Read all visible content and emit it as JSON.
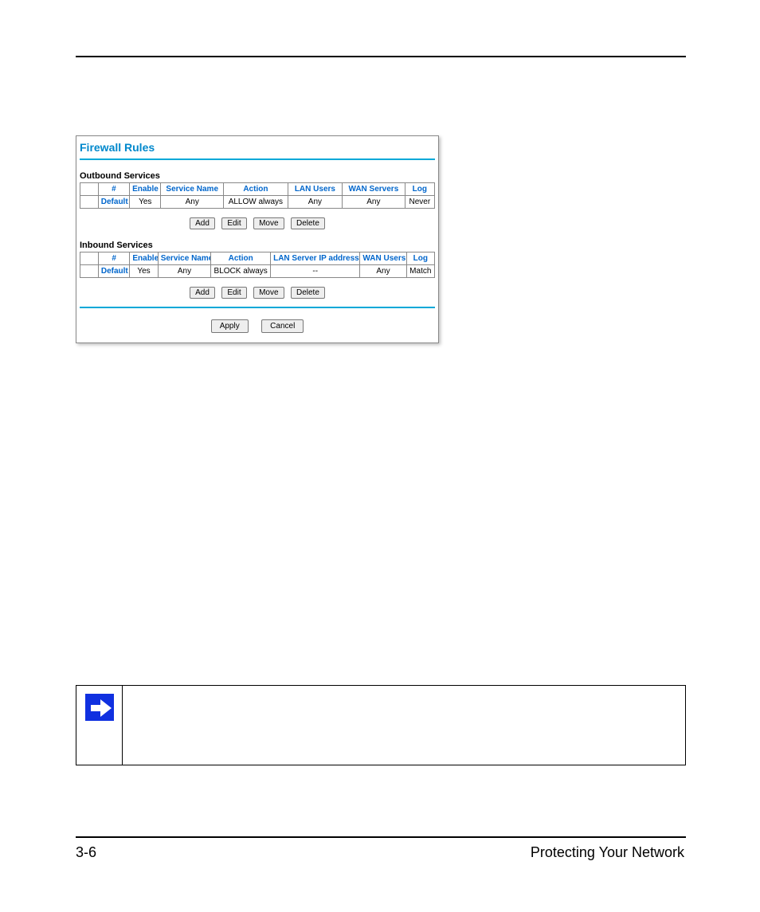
{
  "panel": {
    "title": "Firewall Rules",
    "outbound": {
      "label": "Outbound Services",
      "headers": [
        "",
        "#",
        "Enable",
        "Service Name",
        "Action",
        "LAN Users",
        "WAN Servers",
        "Log"
      ],
      "row": {
        "sel": "",
        "num": "Default",
        "enable": "Yes",
        "service": "Any",
        "action": "ALLOW always",
        "lan": "Any",
        "wan": "Any",
        "log": "Never"
      }
    },
    "inbound": {
      "label": "Inbound Services",
      "headers": [
        "",
        "#",
        "Enable",
        "Service Name",
        "Action",
        "LAN Server IP address",
        "WAN Users",
        "Log"
      ],
      "row": {
        "sel": "",
        "num": "Default",
        "enable": "Yes",
        "service": "Any",
        "action": "BLOCK always",
        "lan": "--",
        "wan": "Any",
        "log": "Match"
      }
    },
    "buttons": {
      "add": "Add",
      "edit": "Edit",
      "move": "Move",
      "delete": "Delete",
      "apply": "Apply",
      "cancel": "Cancel"
    }
  },
  "footer": {
    "page": "3-6",
    "section": "Protecting Your Network"
  }
}
